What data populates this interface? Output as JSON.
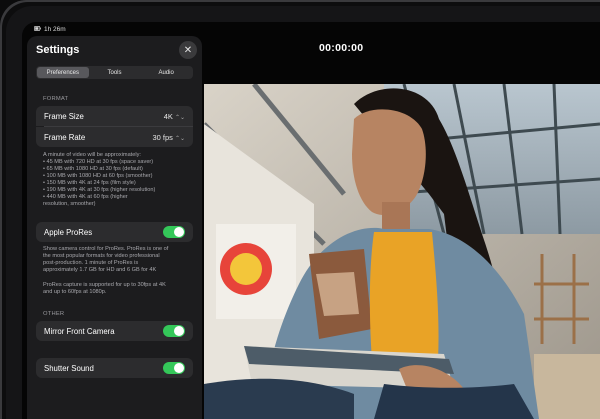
{
  "status": {
    "battery_text": "1h 26m"
  },
  "timer": "00:00:00",
  "settings": {
    "title": "Settings",
    "tabs": [
      {
        "label": "Preferences",
        "active": true
      },
      {
        "label": "Tools",
        "active": false
      },
      {
        "label": "Audio",
        "active": false
      }
    ],
    "format_header": "FORMAT",
    "frame_size": {
      "label": "Frame Size",
      "value": "4K"
    },
    "frame_rate": {
      "label": "Frame Rate",
      "value": "30 fps"
    },
    "storage_note": [
      "A minute of video will be approximately:",
      "• 45 MB with 720 HD at 30 fps (space saver)",
      "• 65 MB with 1080 HD at 30 fps (default)",
      "• 100 MB with 1080 HD at 60 fps (smoother)",
      "• 150 MB with 4K at 24 fps (film style)",
      "• 190 MB with 4K at 30 fps (higher resolution)",
      "• 440 MB with 4K at 60 fps (higher",
      "resolution, smoother)"
    ],
    "apple_prores": {
      "label": "Apple ProRes",
      "on": true
    },
    "prores_note_1": [
      "Show camera control for ProRes. ProRes is one of",
      "the most popular formats for video professional",
      "post-production. 1 minute of ProRes is",
      "approximately 1.7 GB for HD and 6 GB for 4K"
    ],
    "prores_note_2": [
      "ProRes capture is supported for up to 30fps at 4K",
      "and up to 60fps at 1080p."
    ],
    "other_header": "OTHER",
    "mirror_front_camera": {
      "label": "Mirror Front Camera",
      "on": true
    },
    "shutter_sound": {
      "label": "Shutter Sound",
      "on": true
    }
  },
  "colors": {
    "toggle_on": "#34c759",
    "panel_bg": "#1c1c1e",
    "row_bg": "#2c2c2e"
  }
}
